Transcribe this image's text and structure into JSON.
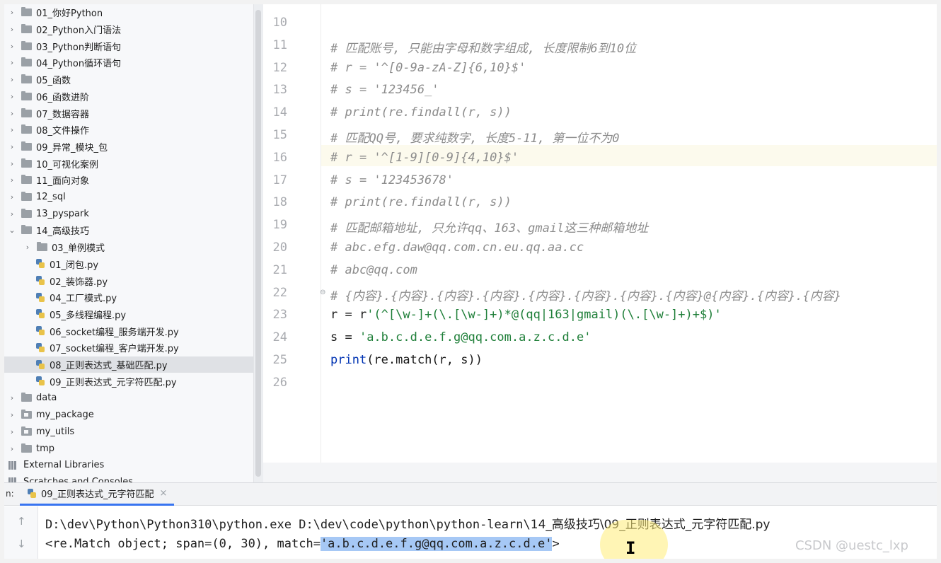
{
  "project_tree": [
    {
      "label": "01_你好Python",
      "type": "folder",
      "depth": 0,
      "expanded": false
    },
    {
      "label": "02_Python入门语法",
      "type": "folder",
      "depth": 0,
      "expanded": false
    },
    {
      "label": "03_Python判断语句",
      "type": "folder",
      "depth": 0,
      "expanded": false
    },
    {
      "label": "04_Python循环语句",
      "type": "folder",
      "depth": 0,
      "expanded": false
    },
    {
      "label": "05_函数",
      "type": "folder",
      "depth": 0,
      "expanded": false
    },
    {
      "label": "06_函数进阶",
      "type": "folder",
      "depth": 0,
      "expanded": false
    },
    {
      "label": "07_数据容器",
      "type": "folder",
      "depth": 0,
      "expanded": false
    },
    {
      "label": "08_文件操作",
      "type": "folder",
      "depth": 0,
      "expanded": false
    },
    {
      "label": "09_异常_模块_包",
      "type": "folder",
      "depth": 0,
      "expanded": false
    },
    {
      "label": "10_可视化案例",
      "type": "folder",
      "depth": 0,
      "expanded": false
    },
    {
      "label": "11_面向对象",
      "type": "folder",
      "depth": 0,
      "expanded": false
    },
    {
      "label": "12_sql",
      "type": "folder",
      "depth": 0,
      "expanded": false
    },
    {
      "label": "13_pyspark",
      "type": "folder",
      "depth": 0,
      "expanded": false
    },
    {
      "label": "14_高级技巧",
      "type": "folder",
      "depth": 0,
      "expanded": true
    },
    {
      "label": "03_单例模式",
      "type": "folder",
      "depth": 1,
      "expanded": false
    },
    {
      "label": "01_闭包.py",
      "type": "py",
      "depth": 1
    },
    {
      "label": "02_装饰器.py",
      "type": "py",
      "depth": 1
    },
    {
      "label": "04_工厂模式.py",
      "type": "py",
      "depth": 1
    },
    {
      "label": "05_多线程编程.py",
      "type": "py",
      "depth": 1
    },
    {
      "label": "06_socket编程_服务端开发.py",
      "type": "py",
      "depth": 1
    },
    {
      "label": "07_socket编程_客户端开发.py",
      "type": "py",
      "depth": 1
    },
    {
      "label": "08_正则表达式_基础匹配.py",
      "type": "py",
      "depth": 1,
      "selected": true
    },
    {
      "label": "09_正则表达式_元字符匹配.py",
      "type": "py",
      "depth": 1
    },
    {
      "label": "data",
      "type": "folder",
      "depth": 0,
      "expanded": false
    },
    {
      "label": "my_package",
      "type": "package",
      "depth": 0,
      "expanded": false
    },
    {
      "label": "my_utils",
      "type": "package",
      "depth": 0,
      "expanded": false
    },
    {
      "label": "tmp",
      "type": "folder",
      "depth": 0,
      "expanded": false
    },
    {
      "label": "External Libraries",
      "type": "library",
      "depth": -1
    },
    {
      "label": "Scratches and Consoles",
      "type": "scratch",
      "depth": -1
    }
  ],
  "editor": {
    "current_line": "16",
    "lines": [
      {
        "num": "10",
        "kind": "blank",
        "parts": []
      },
      {
        "num": "11",
        "kind": "comment",
        "parts": [
          {
            "t": "# 匹配账号, 只能由字母和数字组成, 长度限制6到10位",
            "c": "c"
          }
        ]
      },
      {
        "num": "12",
        "kind": "comment",
        "parts": [
          {
            "t": "# r = '^[0-9a-zA-Z]{6,10}$'",
            "c": "c"
          }
        ]
      },
      {
        "num": "13",
        "kind": "comment",
        "parts": [
          {
            "t": "# s = '123456_'",
            "c": "c"
          }
        ]
      },
      {
        "num": "14",
        "kind": "comment",
        "parts": [
          {
            "t": "# print(re.findall(r, s))",
            "c": "c"
          }
        ]
      },
      {
        "num": "15",
        "kind": "comment",
        "parts": [
          {
            "t": "# 匹配QQ号, 要求纯数字, 长度5-11, 第一位不为0",
            "c": "c"
          }
        ]
      },
      {
        "num": "16",
        "kind": "comment",
        "parts": [
          {
            "t": "# r = '^[1-9][0-9]{4,10}$'",
            "c": "c"
          }
        ]
      },
      {
        "num": "17",
        "kind": "comment",
        "parts": [
          {
            "t": "# s = '123453678'",
            "c": "c"
          }
        ]
      },
      {
        "num": "18",
        "kind": "comment",
        "parts": [
          {
            "t": "# print(re.findall(r, s))",
            "c": "c"
          }
        ]
      },
      {
        "num": "19",
        "kind": "comment",
        "parts": [
          {
            "t": "# 匹配邮箱地址, 只允许qq、163、gmail这三种邮箱地址",
            "c": "c"
          }
        ]
      },
      {
        "num": "20",
        "kind": "comment",
        "parts": [
          {
            "t": "# abc.efg.daw@qq.com.cn.eu.qq.aa.cc",
            "c": "c"
          }
        ]
      },
      {
        "num": "21",
        "kind": "comment",
        "parts": [
          {
            "t": "# abc@qq.com",
            "c": "c"
          }
        ]
      },
      {
        "num": "22",
        "kind": "comment",
        "parts": [
          {
            "t": "# {内容}.{内容}.{内容}.{内容}.{内容}.{内容}.{内容}.{内容}@{内容}.{内容}.{内容}",
            "c": "c"
          }
        ]
      },
      {
        "num": "23",
        "kind": "code",
        "parts": [
          {
            "t": "r = r",
            "c": "fn"
          },
          {
            "t": "'(^[\\w-]+(\\.[\\w-]+)*@(qq|163|gmail)(\\.[\\w-]+)+$)'",
            "c": "str"
          }
        ]
      },
      {
        "num": "24",
        "kind": "code",
        "parts": [
          {
            "t": "s = ",
            "c": "fn"
          },
          {
            "t": "'a.b.c.d.e.f.g@qq.com.a.z.c.d.e'",
            "c": "str"
          }
        ]
      },
      {
        "num": "25",
        "kind": "code",
        "parts": [
          {
            "t": "print",
            "c": "kw"
          },
          {
            "t": "(re.match(r, s))",
            "c": "fn"
          }
        ]
      },
      {
        "num": "26",
        "kind": "blank",
        "parts": []
      }
    ]
  },
  "run": {
    "prefix": "n:",
    "tab_label": "09_正则表达式_元字符匹配",
    "close_glyph": "×",
    "cmd_ascii": "D:\\dev\\Python\\Python310\\python.exe D:\\dev\\code\\python\\python-learn\\",
    "cmd_cjk": "14_高级技巧\\09_正则表达式_元字符匹配.py",
    "result_prefix": "<re.Match object; span=(0, 30), match=",
    "result_match": "'a.b.c.d.e.f.g@qq.com.a.z.c.d.e'",
    "result_suffix": ">",
    "up_arrow": "↑",
    "down_arrow": "↓"
  },
  "watermark": "CSDN @uestc_lxp"
}
